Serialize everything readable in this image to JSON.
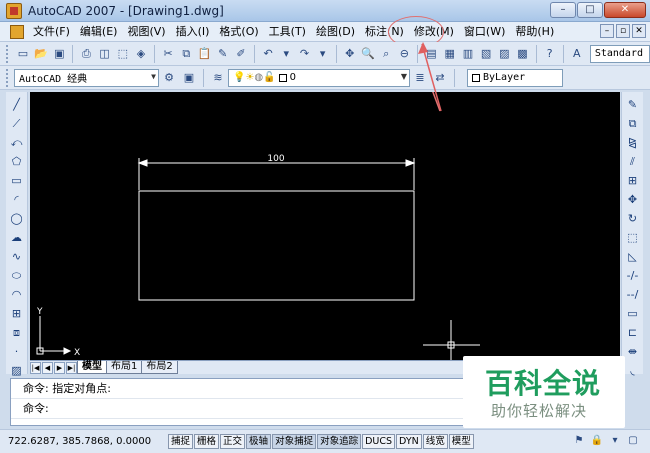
{
  "window": {
    "title": "AutoCAD 2007 - [Drawing1.dwg]",
    "buttons": {
      "minimize": "–",
      "maximize": "□",
      "close": "✕"
    }
  },
  "menu": {
    "items": [
      {
        "label": "文件(F)"
      },
      {
        "label": "编辑(E)"
      },
      {
        "label": "视图(V)"
      },
      {
        "label": "插入(I)"
      },
      {
        "label": "格式(O)"
      },
      {
        "label": "工具(T)"
      },
      {
        "label": "绘图(D)"
      },
      {
        "label": "标注(N)"
      },
      {
        "label": "修改(M)",
        "highlighted": true
      },
      {
        "label": "窗口(W)"
      },
      {
        "label": "帮助(H)"
      }
    ],
    "mdi_buttons": [
      "–",
      "▫",
      "✕"
    ]
  },
  "toolbar": {
    "text_style": "Standard"
  },
  "properties_toolbar": {
    "workspace": "AutoCAD 经典",
    "layer": "0",
    "color": "ByLayer"
  },
  "drawing": {
    "dimension_text": "100",
    "ucs": {
      "x_label": "X",
      "y_label": "Y"
    }
  },
  "layout_tabs": {
    "nav": [
      "|◀",
      "◀",
      "▶",
      "▶|"
    ],
    "tabs": [
      {
        "label": "模型",
        "active": true
      },
      {
        "label": "布局1"
      },
      {
        "label": "布局2"
      }
    ]
  },
  "command": {
    "line1": "命令: 指定对角点:",
    "line2": "命令:"
  },
  "status": {
    "coords": "722.6287, 385.7868, 0.0000",
    "toggles": [
      "捕捉",
      "栅格",
      "正交",
      "极轴",
      "对象捕捉",
      "对象追踪",
      "DUCS",
      "DYN",
      "线宽",
      "模型"
    ]
  },
  "watermark": {
    "title": "百科全说",
    "subtitle": "助你轻松解决"
  },
  "colors": {
    "canvas_bg": "#000000",
    "drawing_lines": "#ffffff",
    "annotation": "#e07070",
    "watermark_green": "#1f9d5e"
  }
}
